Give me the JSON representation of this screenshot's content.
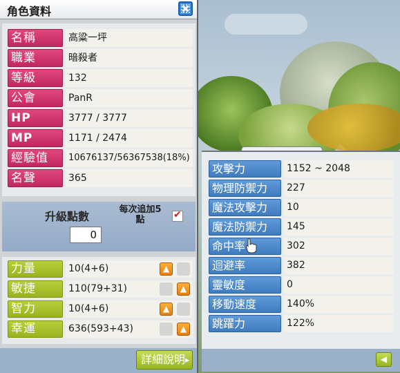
{
  "window": {
    "title": "角色資料"
  },
  "profile": [
    {
      "label": "名稱",
      "value": "高粱一坪"
    },
    {
      "label": "職業",
      "value": "暗殺者"
    },
    {
      "label": "等級",
      "value": "132"
    },
    {
      "label": "公會",
      "value": "PanR"
    },
    {
      "label": "HP",
      "value": "3777 / 3777"
    },
    {
      "label": "MP",
      "value": "1171 / 2474"
    },
    {
      "label": "經驗值",
      "value": "10676137/56367538(18%)"
    },
    {
      "label": "名聲",
      "value": "365"
    }
  ],
  "ability_points": {
    "label": "升級點數",
    "value": "0",
    "auto_label_line1": "每次追加5",
    "auto_label_line2": "點",
    "auto_checked_mark": "✔"
  },
  "stats": [
    {
      "label": "力量",
      "value": "10(4+6)",
      "up_enabled": true
    },
    {
      "label": "敏捷",
      "value": "110(79+31)",
      "up_enabled": true
    },
    {
      "label": "智力",
      "value": "10(4+6)",
      "up_enabled": true
    },
    {
      "label": "幸運",
      "value": "636(593+43)",
      "up_enabled": true
    }
  ],
  "detail_button": {
    "label": "詳細說明",
    "arrow": "▸"
  },
  "detail_stats": [
    {
      "label": "攻擊力",
      "value": "1152 ~ 2048"
    },
    {
      "label": "物理防禦力",
      "value": "227"
    },
    {
      "label": "魔法攻擊力",
      "value": "10"
    },
    {
      "label": "魔法防禦力",
      "value": "145"
    },
    {
      "label": "命中率",
      "value": "302"
    },
    {
      "label": "迴避率",
      "value": "382"
    },
    {
      "label": "靈敏度",
      "value": "0"
    },
    {
      "label": "移動速度",
      "value": "140%"
    },
    {
      "label": "跳躍力",
      "value": "122%"
    }
  ],
  "icons": {
    "close": "close-icon",
    "up_arrow": "▲",
    "back_arrow": "◀"
  },
  "colors": {
    "profile_label": "#c1285f",
    "stat_label": "#9ab21f",
    "detail_label": "#3f7bbf",
    "up_button": "#e67d0d",
    "close_button": "#3f8de0"
  }
}
